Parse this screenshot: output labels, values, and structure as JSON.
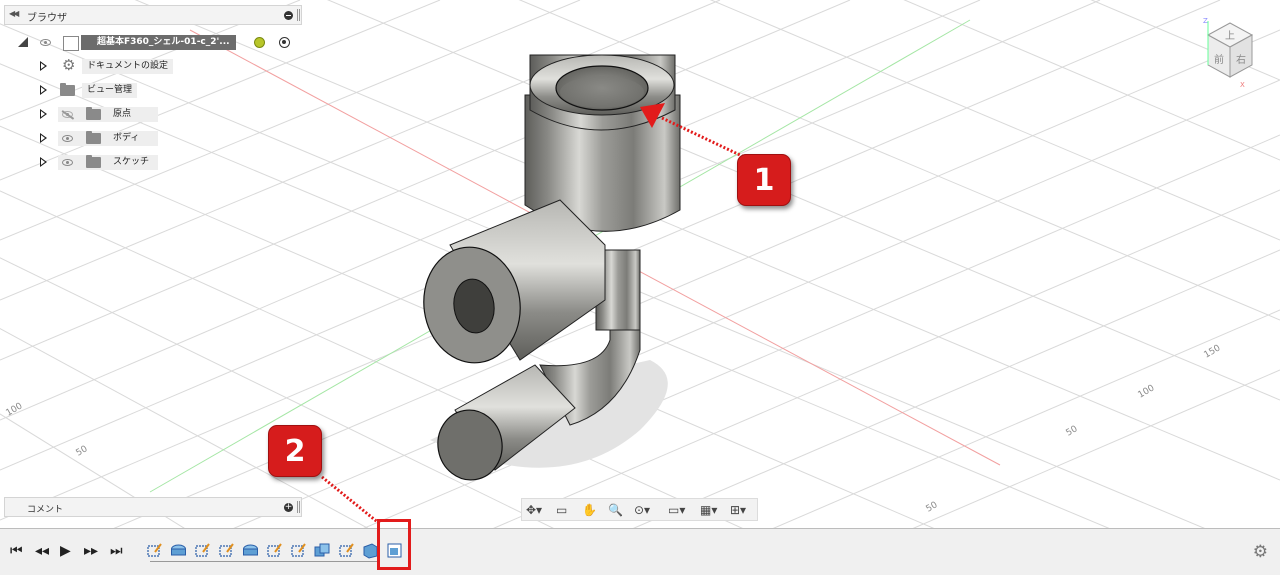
{
  "browser": {
    "title": "ブラウザ",
    "root_label": "超基本F360_シェル-01-c_2'...",
    "items": [
      {
        "label": "ドキュメントの設定",
        "icon": "gear-icon",
        "visibility": "none"
      },
      {
        "label": "ビュー管理",
        "icon": "folder-icon",
        "visibility": "none"
      },
      {
        "label": "原点",
        "icon": "folder-icon",
        "visibility": "hidden"
      },
      {
        "label": "ボディ",
        "icon": "folder-icon",
        "visibility": "visible"
      },
      {
        "label": "スケッチ",
        "icon": "folder-icon",
        "visibility": "visible"
      }
    ]
  },
  "comments": {
    "title": "コメント"
  },
  "grid_labels": [
    "100",
    "50",
    "150",
    "100",
    "50",
    "50"
  ],
  "viewcube": {
    "top": "上",
    "front": "前",
    "right": "右",
    "axis_z": "Z",
    "axis_x": "X"
  },
  "callouts": [
    "1",
    "2"
  ],
  "nav_toolbar": [
    "orbit-icon",
    "look-at-icon",
    "pan-icon",
    "zoom-icon",
    "fit-icon",
    "display-settings-icon",
    "grid-icon",
    "viewports-icon"
  ],
  "timeline": {
    "controls": [
      "skip-to-start-icon",
      "step-back-icon",
      "play-icon",
      "step-forward-icon",
      "skip-to-end-icon"
    ],
    "features": [
      "sketch",
      "extrude",
      "sketch",
      "sketch",
      "extrude",
      "sketch",
      "sketch",
      "combine",
      "sketch",
      "body",
      "shell"
    ],
    "settings_icon": "gear-icon"
  },
  "colors": {
    "accent": "#e21b1b",
    "grid_line": "#d8d8d8",
    "axis_red": "#f08080",
    "axis_green": "#7fdc7f"
  }
}
